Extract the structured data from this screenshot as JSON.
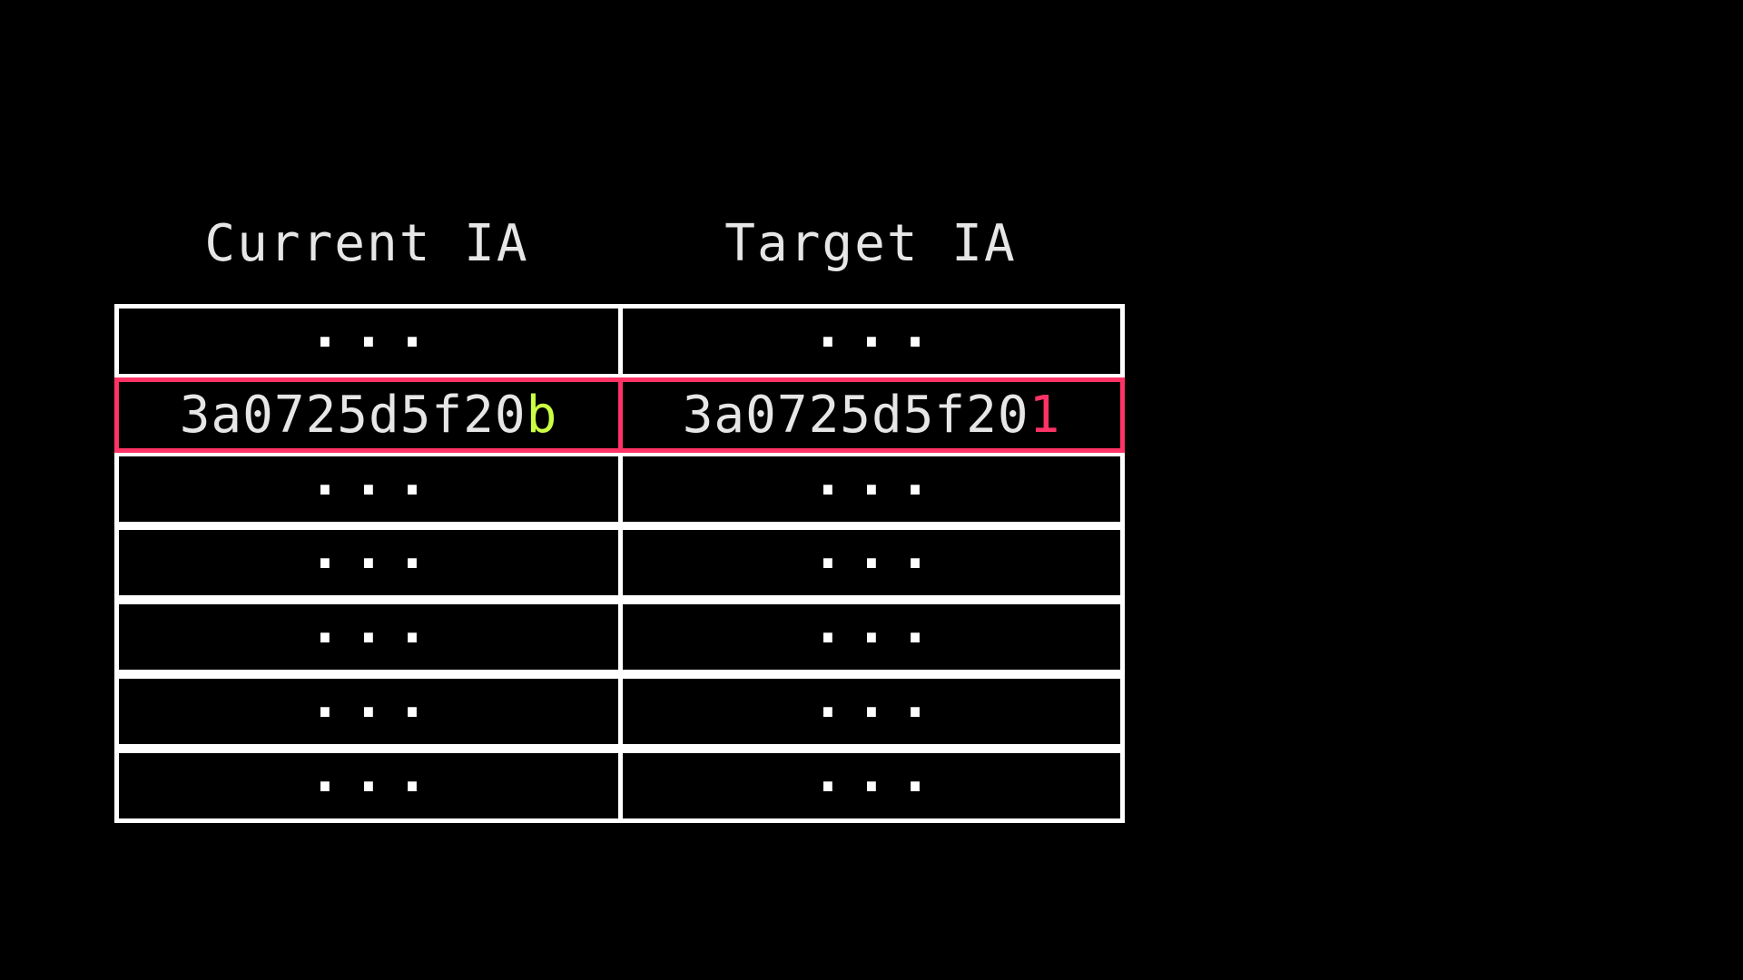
{
  "headers": {
    "current": "Current IA",
    "target": "Target IA"
  },
  "rows": [
    {
      "current": "...",
      "target": "..."
    },
    {
      "current_prefix": "3a0725d5f20",
      "current_diff": "b",
      "target_prefix": "3a0725d5f20",
      "target_diff": "1",
      "highlighted": true
    },
    {
      "current": "...",
      "target": "..."
    },
    {
      "current": "...",
      "target": "..."
    },
    {
      "current": "...",
      "target": "..."
    },
    {
      "current": "...",
      "target": "..."
    },
    {
      "current": "...",
      "target": "..."
    }
  ],
  "colors": {
    "highlight": "#ff3366",
    "current_diff": "#ccff44",
    "target_diff": "#ff3366",
    "border": "#ffffff",
    "background": "#000000"
  }
}
